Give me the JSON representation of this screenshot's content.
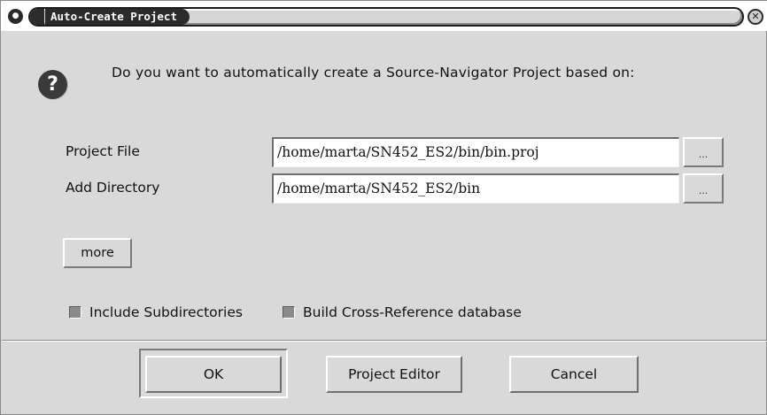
{
  "window": {
    "title": "Auto-Create Project",
    "menu_glyph": "●",
    "close_glyph": "✕"
  },
  "dialog": {
    "prompt": "Do you want to automatically create a Source-Navigator Project based on:",
    "icon": "question-icon",
    "icon_glyph": "?"
  },
  "fields": {
    "project_file": {
      "label": "Project File",
      "value": "/home/marta/SN452_ES2/bin/bin.proj",
      "browse_label": "..."
    },
    "add_directory": {
      "label": "Add Directory",
      "value": "/home/marta/SN452_ES2/bin",
      "browse_label": "..."
    }
  },
  "more_label": "more",
  "options": {
    "include_subdirectories": {
      "label": "Include Subdirectories",
      "checked": true
    },
    "build_xref": {
      "label": "Build Cross-Reference database",
      "checked": true
    }
  },
  "buttons": {
    "ok": "OK",
    "project_editor": "Project Editor",
    "cancel": "Cancel"
  },
  "colors": {
    "background": "#d9d9d9",
    "title_label_bg": "#2b2b2b",
    "entry_bg": "#ffffff",
    "checkbox_fill": "#8a8a8a"
  }
}
